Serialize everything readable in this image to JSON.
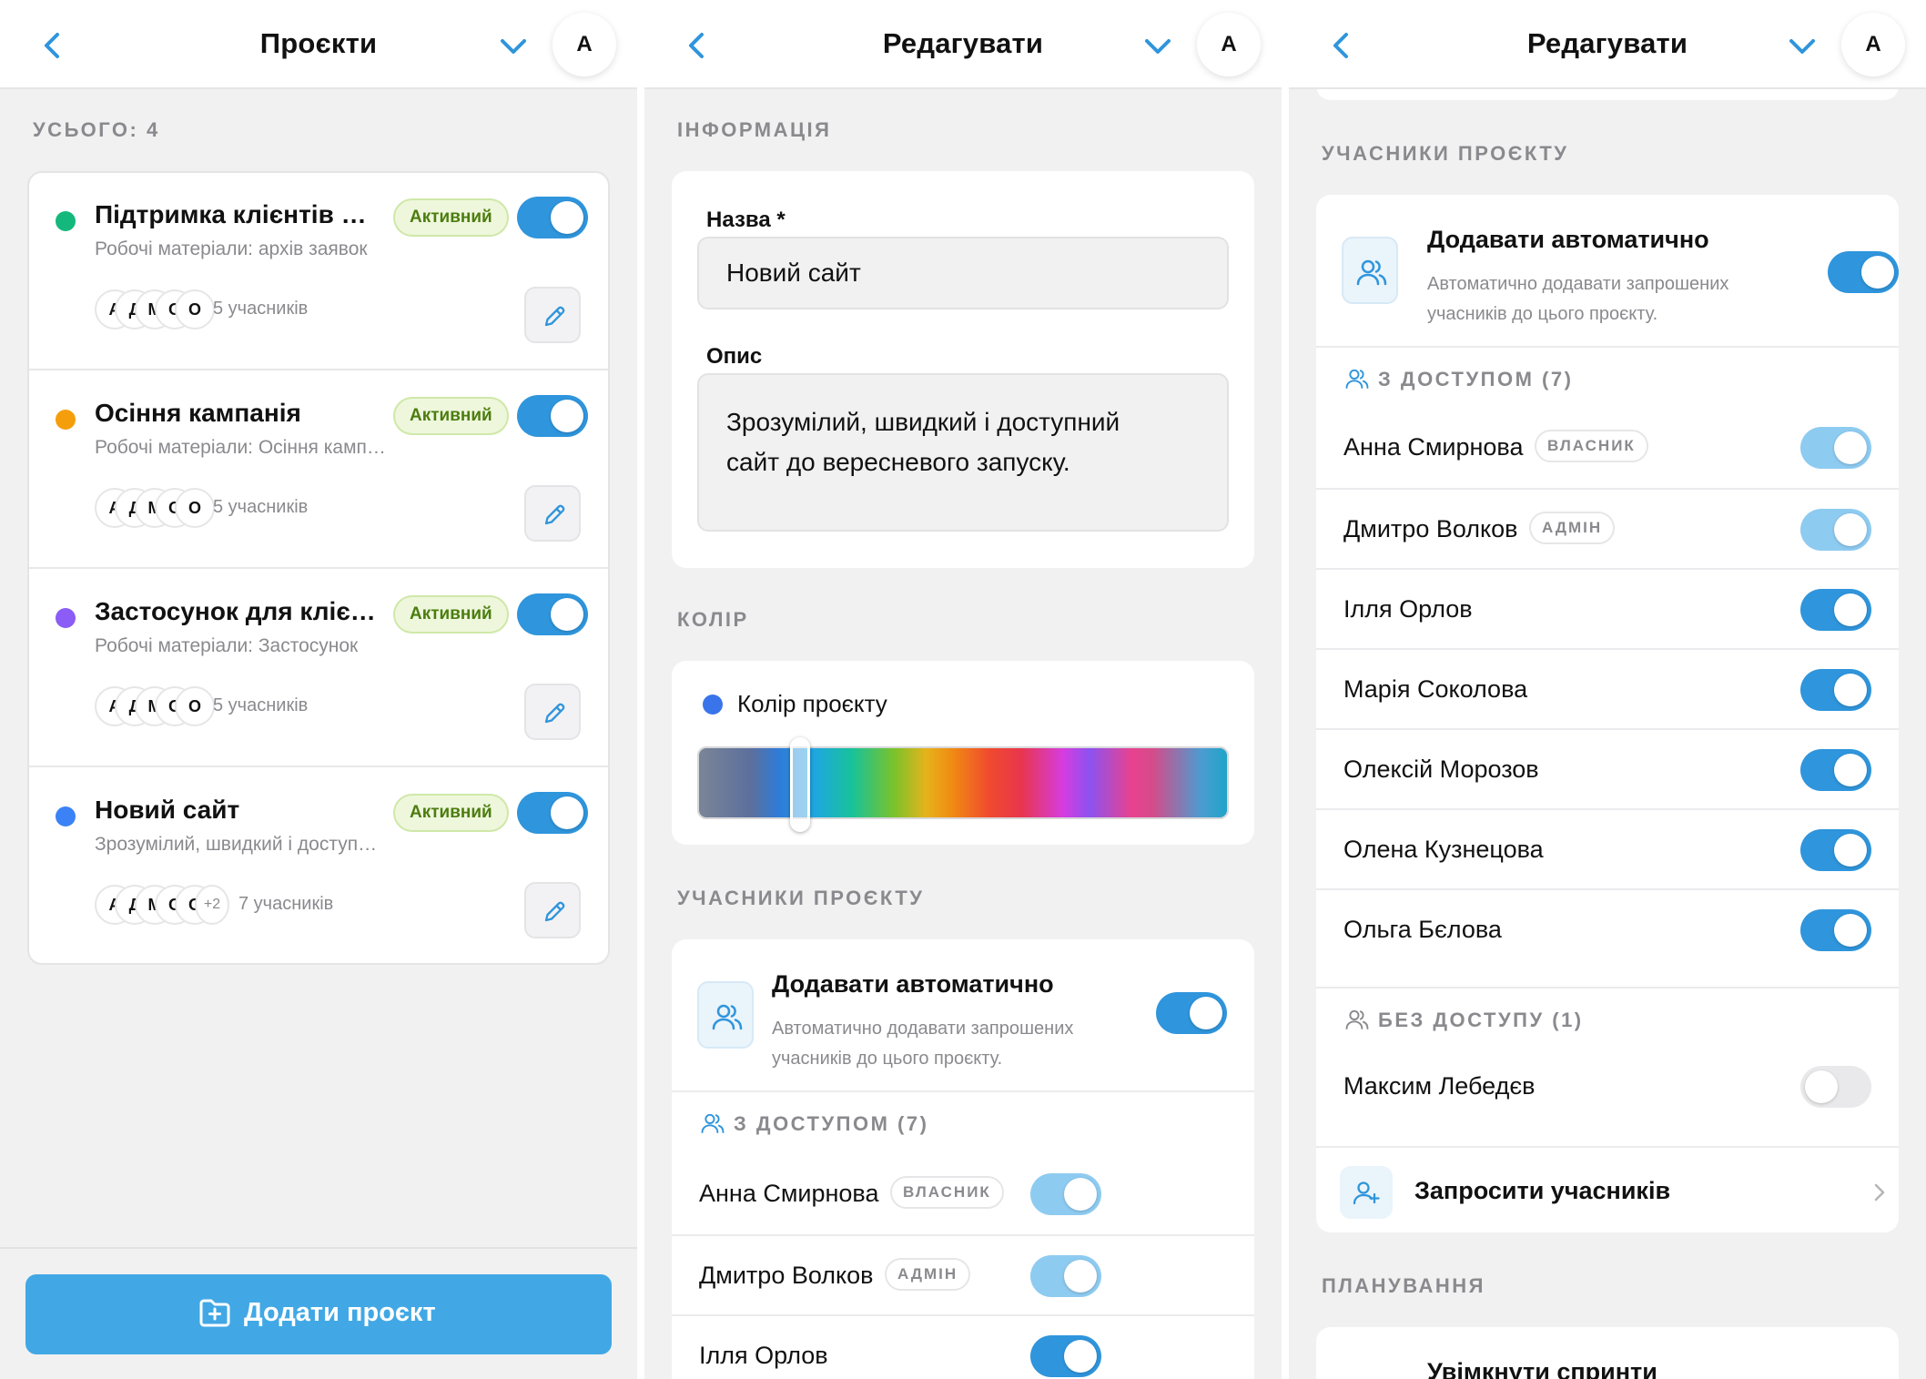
{
  "screen1": {
    "header": {
      "title": "Проєкти",
      "avatar": "А"
    },
    "total_label": "УСЬОГО: 4",
    "projects": [
      {
        "color": "#14b87c",
        "name": "Підтримка клієнтів — сервіс",
        "desc": "Робочі матеріали: архів заявок",
        "status": "Активний",
        "avatars": [
          "А",
          "Д",
          "М",
          "О",
          "О"
        ],
        "extra": "",
        "members": "5 учасників",
        "enabled": true
      },
      {
        "color": "#f59e0b",
        "name": "Осіння кампанія",
        "desc": "Робочі матеріали: Осіння кампанія",
        "status": "Активний",
        "avatars": [
          "А",
          "Д",
          "М",
          "О",
          "О"
        ],
        "extra": "",
        "members": "5 учасників",
        "enabled": true
      },
      {
        "color": "#8b5cf6",
        "name": "Застосунок для клієнтів",
        "desc": "Робочі матеріали: Застосунок",
        "status": "Активний",
        "avatars": [
          "А",
          "Д",
          "М",
          "О",
          "О"
        ],
        "extra": "",
        "members": "5 учасників",
        "enabled": true
      },
      {
        "color": "#3b82f6",
        "name": "Новий сайт",
        "desc": "Зрозумілий, швидкий і доступний",
        "status": "Активний",
        "avatars": [
          "А",
          "Д",
          "М",
          "О",
          "О"
        ],
        "extra": "+2",
        "members": "7 учасників",
        "enabled": true
      }
    ],
    "add_button_label": "Додати проєкт"
  },
  "screen2": {
    "header": {
      "title": "Редагувати",
      "avatar": "А"
    },
    "info_section": "ІНФОРМАЦІЯ",
    "name_label": "Назва *",
    "name_value": "Новий сайт",
    "desc_label": "Опис",
    "desc_value_line1": "Зрозумілий, швидкий і доступний",
    "desc_value_line2": "сайт до вересневого запуску.",
    "color_section": "КОЛІР",
    "color_label": "Колір проєкту",
    "color_value": "#3a74ea",
    "members_section": "УЧАСНИКИ ПРОЄКТУ",
    "auto_title": "Додавати автоматично",
    "auto_desc_line1": "Автоматично додавати запрошених",
    "auto_desc_line2": "учасників до цього проєкту.",
    "access_group": "З ДОСТУПОМ (7)",
    "members": [
      {
        "name": "Анна Смирнова",
        "role": "ВЛАСНИК",
        "enabled": true,
        "locked": true
      },
      {
        "name": "Дмитро Волков",
        "role": "АДМІН",
        "enabled": true,
        "locked": true
      },
      {
        "name": "Ілля Орлов",
        "role": "",
        "enabled": true,
        "locked": false
      }
    ]
  },
  "screen3": {
    "header": {
      "title": "Редагувати",
      "avatar": "А"
    },
    "members_section": "УЧАСНИКИ ПРОЄКТУ",
    "auto_title": "Додавати автоматично",
    "auto_desc_line1": "Автоматично додавати запрошених",
    "auto_desc_line2": "учасників до цього проєкту.",
    "access_group": "З ДОСТУПОМ (7)",
    "members": [
      {
        "name": "Анна Смирнова",
        "role": "ВЛАСНИК",
        "enabled": true,
        "locked": true
      },
      {
        "name": "Дмитро Волков",
        "role": "АДМІН",
        "enabled": true,
        "locked": true
      },
      {
        "name": "Ілля Орлов",
        "role": "",
        "enabled": true,
        "locked": false
      },
      {
        "name": "Марія Соколова",
        "role": "",
        "enabled": true,
        "locked": false
      },
      {
        "name": "Олексій Морозов",
        "role": "",
        "enabled": true,
        "locked": false
      },
      {
        "name": "Олена Кузнецова",
        "role": "",
        "enabled": true,
        "locked": false
      },
      {
        "name": "Ольга Бєлова",
        "role": "",
        "enabled": true,
        "locked": false
      }
    ],
    "no_access_group": "БЕЗ ДОСТУПУ (1)",
    "no_access_members": [
      {
        "name": "Максим Лебедєв",
        "enabled": false
      }
    ],
    "invite_label": "Запросити учасників",
    "planning_section": "ПЛАНУВАННЯ",
    "sprints_label": "Увімкнути спринти"
  },
  "icons": {
    "back": "chevron-left-icon",
    "menu": "chevron-down-icon",
    "edit": "pencil-icon",
    "people": "users-icon",
    "invite": "user-plus-icon",
    "add_folder": "folder-plus-icon"
  },
  "colors": {
    "accent": "#2f95dc",
    "button": "#41a8e5",
    "active_badge": "#4c7d0f"
  }
}
